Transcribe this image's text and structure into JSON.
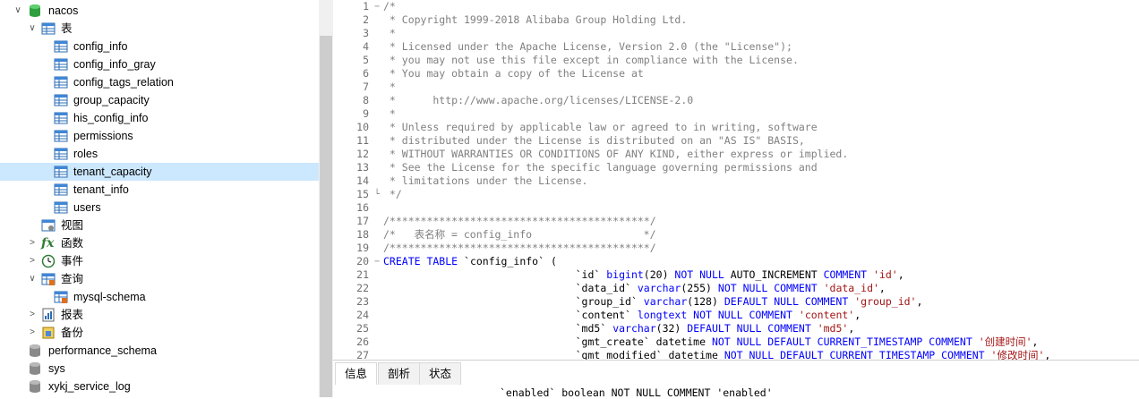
{
  "sidebar": {
    "db_nacos": "nacos",
    "tables_folder": "表",
    "tables": [
      "config_info",
      "config_info_gray",
      "config_tags_relation",
      "group_capacity",
      "his_config_info",
      "permissions",
      "roles",
      "tenant_capacity",
      "tenant_info",
      "users"
    ],
    "selected_table": "tenant_capacity",
    "views_folder": "视图",
    "functions_folder": "函数",
    "events_folder": "事件",
    "queries_folder": "查询",
    "query_item": "mysql-schema",
    "reports_folder": "报表",
    "backup_folder": "备份",
    "other_dbs": [
      "performance_schema",
      "sys",
      "xykj_service_log"
    ]
  },
  "editor": {
    "lines": [
      {
        "n": "1",
        "html": "<span class=\"cm\">/*</span>"
      },
      {
        "n": "2",
        "html": "<span class=\"cm\"> * Copyright 1999-2018 Alibaba Group Holding Ltd.</span>"
      },
      {
        "n": "3",
        "html": "<span class=\"cm\"> *</span>"
      },
      {
        "n": "4",
        "html": "<span class=\"cm\"> * Licensed under the Apache License, Version 2.0 (the \"License\");</span>"
      },
      {
        "n": "5",
        "html": "<span class=\"cm\"> * you may not use this file except in compliance with the License.</span>"
      },
      {
        "n": "6",
        "html": "<span class=\"cm\"> * You may obtain a copy of the License at</span>"
      },
      {
        "n": "7",
        "html": "<span class=\"cm\"> *</span>"
      },
      {
        "n": "8",
        "html": "<span class=\"cm\"> *      http://www.apache.org/licenses/LICENSE-2.0</span>"
      },
      {
        "n": "9",
        "html": "<span class=\"cm\"> *</span>"
      },
      {
        "n": "10",
        "html": "<span class=\"cm\"> * Unless required by applicable law or agreed to in writing, software</span>"
      },
      {
        "n": "11",
        "html": "<span class=\"cm\"> * distributed under the License is distributed on an \"AS IS\" BASIS,</span>"
      },
      {
        "n": "12",
        "html": "<span class=\"cm\"> * WITHOUT WARRANTIES OR CONDITIONS OF ANY KIND, either express or implied.</span>"
      },
      {
        "n": "13",
        "html": "<span class=\"cm\"> * See the License for the specific language governing permissions and</span>"
      },
      {
        "n": "14",
        "html": "<span class=\"cm\"> * limitations under the License.</span>"
      },
      {
        "n": "15",
        "html": "<span class=\"cm\"> */</span>"
      },
      {
        "n": "16",
        "html": ""
      },
      {
        "n": "17",
        "html": "<span class=\"cm\">/******************************************/</span>"
      },
      {
        "n": "18",
        "html": "<span class=\"cm\">/*   表名称 = config_info                  */</span>"
      },
      {
        "n": "19",
        "html": "<span class=\"cm\">/******************************************/</span>"
      },
      {
        "n": "20",
        "html": "<span class=\"kw\">CREATE TABLE</span> `config_info` ("
      },
      {
        "n": "21",
        "html": "                               `id` <span class=\"kw\">bigint</span>(20) <span class=\"kw\">NOT NULL</span> AUTO_INCREMENT <span class=\"kw\">COMMENT</span> <span class=\"str\">'id'</span>,"
      },
      {
        "n": "22",
        "html": "                               `data_id` <span class=\"kw\">varchar</span>(255) <span class=\"kw\">NOT NULL COMMENT</span> <span class=\"str\">'data_id'</span>,"
      },
      {
        "n": "23",
        "html": "                               `group_id` <span class=\"kw\">varchar</span>(128) <span class=\"kw\">DEFAULT NULL COMMENT</span> <span class=\"str\">'group_id'</span>,"
      },
      {
        "n": "24",
        "html": "                               `content` <span class=\"kw\">longtext NOT NULL COMMENT</span> <span class=\"str\">'content'</span>,"
      },
      {
        "n": "25",
        "html": "                               `md5` <span class=\"kw\">varchar</span>(32) <span class=\"kw\">DEFAULT NULL COMMENT</span> <span class=\"str\">'md5'</span>,"
      },
      {
        "n": "26",
        "html": "                               `gmt_create` datetime <span class=\"kw\">NOT NULL DEFAULT CURRENT_TIMESTAMP COMMENT</span> <span class=\"str\">'创建时间'</span>,"
      },
      {
        "n": "27",
        "html": "                               `gmt_modified` datetime <span class=\"kw\">NOT NULL DEFAULT CURRENT_TIMESTAMP COMMENT</span> <span class=\"str\">'修改时间'</span>,"
      }
    ]
  },
  "bottom_tabs": [
    "信息",
    "剖析",
    "状态"
  ],
  "info_text": "`enabled` boolean NOT NULL COMMENT 'enabled'",
  "colors": {
    "selected_row": "#cce8ff",
    "comment": "#808080",
    "keyword": "#0000ff",
    "string": "#a31515"
  }
}
